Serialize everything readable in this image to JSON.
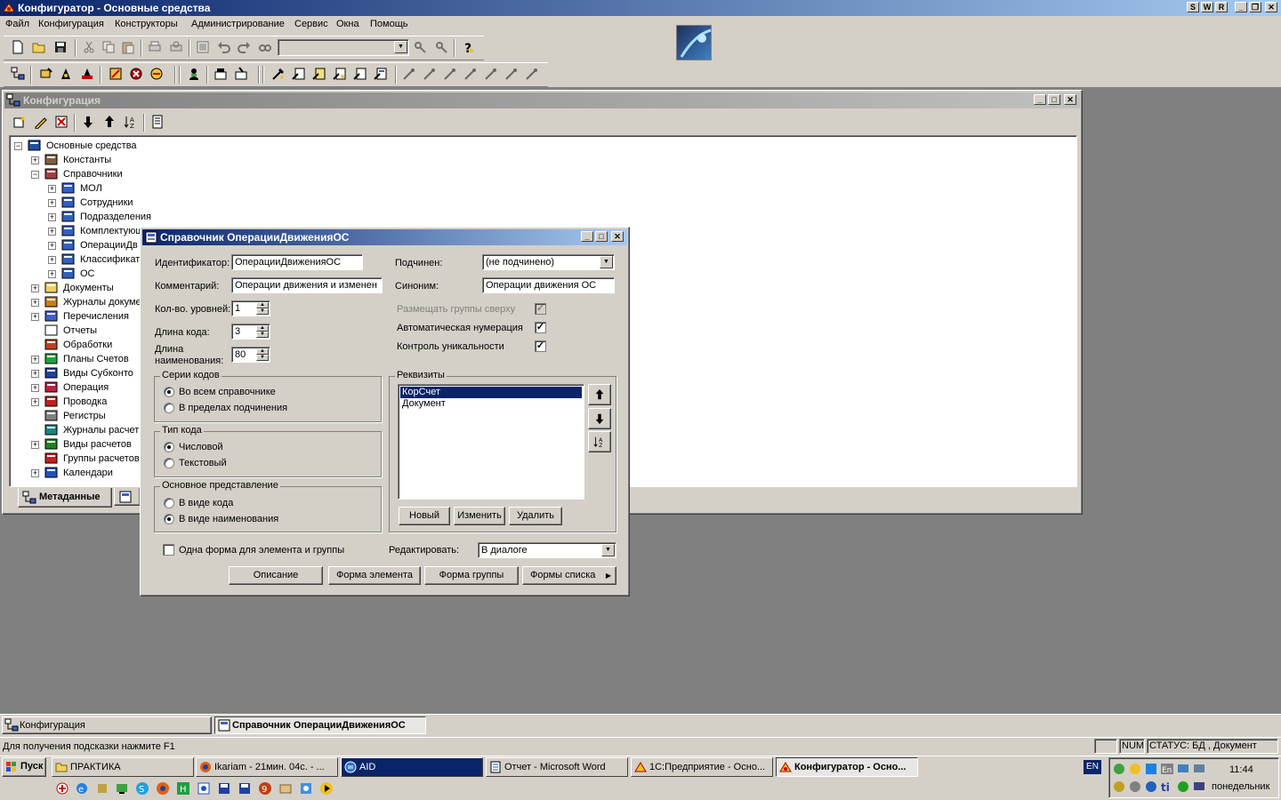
{
  "app": {
    "title": "Конфигуратор - Основные средства",
    "title_buttons": [
      "S",
      "W",
      "R"
    ]
  },
  "menu": [
    "Файл",
    "Конфигурация",
    "Конструкторы",
    "Администрирование",
    "Сервис",
    "Окна",
    "Помощь"
  ],
  "config_window": {
    "title": "Конфигурация",
    "tree": [
      {
        "label": "Основные средства",
        "level": 0,
        "icon": "database-icon",
        "expander": "minus"
      },
      {
        "label": "Константы",
        "level": 1,
        "icon": "constants-icon",
        "expander": "plus"
      },
      {
        "label": "Справочники",
        "level": 1,
        "icon": "catalogs-icon",
        "expander": "minus"
      },
      {
        "label": "МОЛ",
        "level": 2,
        "icon": "catalog-icon",
        "expander": "plus"
      },
      {
        "label": "Сотрудники",
        "level": 2,
        "icon": "catalog-icon",
        "expander": "plus"
      },
      {
        "label": "Подразделения",
        "level": 2,
        "icon": "catalog-icon",
        "expander": "plus"
      },
      {
        "label": "Комплектующ",
        "level": 2,
        "icon": "catalog-icon",
        "expander": "plus"
      },
      {
        "label": "ОперацииДв",
        "level": 2,
        "icon": "catalog-icon",
        "expander": "plus"
      },
      {
        "label": "Классификат",
        "level": 2,
        "icon": "catalog-icon",
        "expander": "plus"
      },
      {
        "label": "ОС",
        "level": 2,
        "icon": "catalog-icon",
        "expander": "plus"
      },
      {
        "label": "Документы",
        "level": 1,
        "icon": "folder-icon",
        "expander": "plus"
      },
      {
        "label": "Журналы докуме",
        "level": 1,
        "icon": "journal-icon",
        "expander": "plus"
      },
      {
        "label": "Перечисления",
        "level": 1,
        "icon": "enum-icon",
        "expander": "plus"
      },
      {
        "label": "Отчеты",
        "level": 1,
        "icon": "report-icon",
        "expander": "none"
      },
      {
        "label": "Обработки",
        "level": 1,
        "icon": "processing-icon",
        "expander": "none"
      },
      {
        "label": "Планы Счетов",
        "level": 1,
        "icon": "accounts-icon",
        "expander": "plus"
      },
      {
        "label": "Виды Субконто",
        "level": 1,
        "icon": "subconto-icon",
        "expander": "plus"
      },
      {
        "label": "Операция",
        "level": 1,
        "icon": "operation-icon",
        "expander": "plus"
      },
      {
        "label": "Проводка",
        "level": 1,
        "icon": "posting-icon",
        "expander": "plus"
      },
      {
        "label": "Регистры",
        "level": 1,
        "icon": "registers-icon",
        "expander": "none"
      },
      {
        "label": "Журналы расчет",
        "level": 1,
        "icon": "calc-journal-icon",
        "expander": "none"
      },
      {
        "label": "Виды расчетов",
        "level": 1,
        "icon": "calc-types-icon",
        "expander": "plus"
      },
      {
        "label": "Группы расчетов",
        "level": 1,
        "icon": "calc-groups-icon",
        "expander": "none"
      },
      {
        "label": "Календари",
        "level": 1,
        "icon": "calendar-icon",
        "expander": "plus"
      }
    ],
    "tabs": [
      "Метаданные"
    ]
  },
  "dialog": {
    "title": "Справочник ОперацииДвиженияОС",
    "identifier_label": "Идентификатор:",
    "identifier_value": "ОперацииДвиженияОС",
    "comment_label": "Комментарий:",
    "comment_value": "Операции движения и изменен",
    "levels_label": "Кол-во. уровней:",
    "levels_value": "1",
    "code_len_label": "Длина кода:",
    "code_len_value": "3",
    "name_len_label1": "Длина",
    "name_len_label2": "наименования:",
    "name_len_value": "80",
    "subordinate_label": "Подчинен:",
    "subordinate_value": "(не подчинено)",
    "synonym_label": "Синоним:",
    "synonym_value": "Операции движения ОС",
    "groups_top_label": "Размещать группы сверху",
    "auto_num_label": "Автоматическая нумерация",
    "unique_label": "Контроль уникальности",
    "code_series_label": "Серии кодов",
    "code_series_opt1": "Во всем справочнике",
    "code_series_opt2": "В пределах подчинения",
    "code_type_label": "Тип кода",
    "code_type_opt1": "Числовой",
    "code_type_opt2": "Текстовый",
    "main_repr_label": "Основное представление",
    "main_repr_opt1": "В виде кода",
    "main_repr_opt2": "В виде наименования",
    "requisites_label": "Реквизиты",
    "requisites": [
      "КорСчет",
      "Документ"
    ],
    "btn_new": "Новый",
    "btn_edit": "Изменить",
    "btn_delete": "Удалить",
    "one_form_label": "Одна форма для элемента и группы",
    "edit_label": "Редактировать:",
    "edit_value": "В диалоге",
    "btn_description": "Описание",
    "btn_elem_form": "Форма элемента",
    "btn_group_form": "Форма группы",
    "btn_list_forms": "Формы списка"
  },
  "mdi_tabs": [
    "Конфигурация",
    "Справочник ОперацииДвиженияОС"
  ],
  "status": {
    "hint": "Для получения подсказки нажмите F1",
    "num": "NUM",
    "status": "СТАТУС: БД , Документ"
  },
  "taskbar": {
    "start": "Пуск",
    "tasks": [
      "ПРАКТИКА",
      "Ikariam - 21мин. 04с. - ...",
      "AID",
      "Отчет - Microsoft Word",
      "1С:Предприятие - Осно...",
      "Конфигуратор - Осно..."
    ],
    "lang": "EN",
    "time": "11:44",
    "day": "понедельник"
  }
}
